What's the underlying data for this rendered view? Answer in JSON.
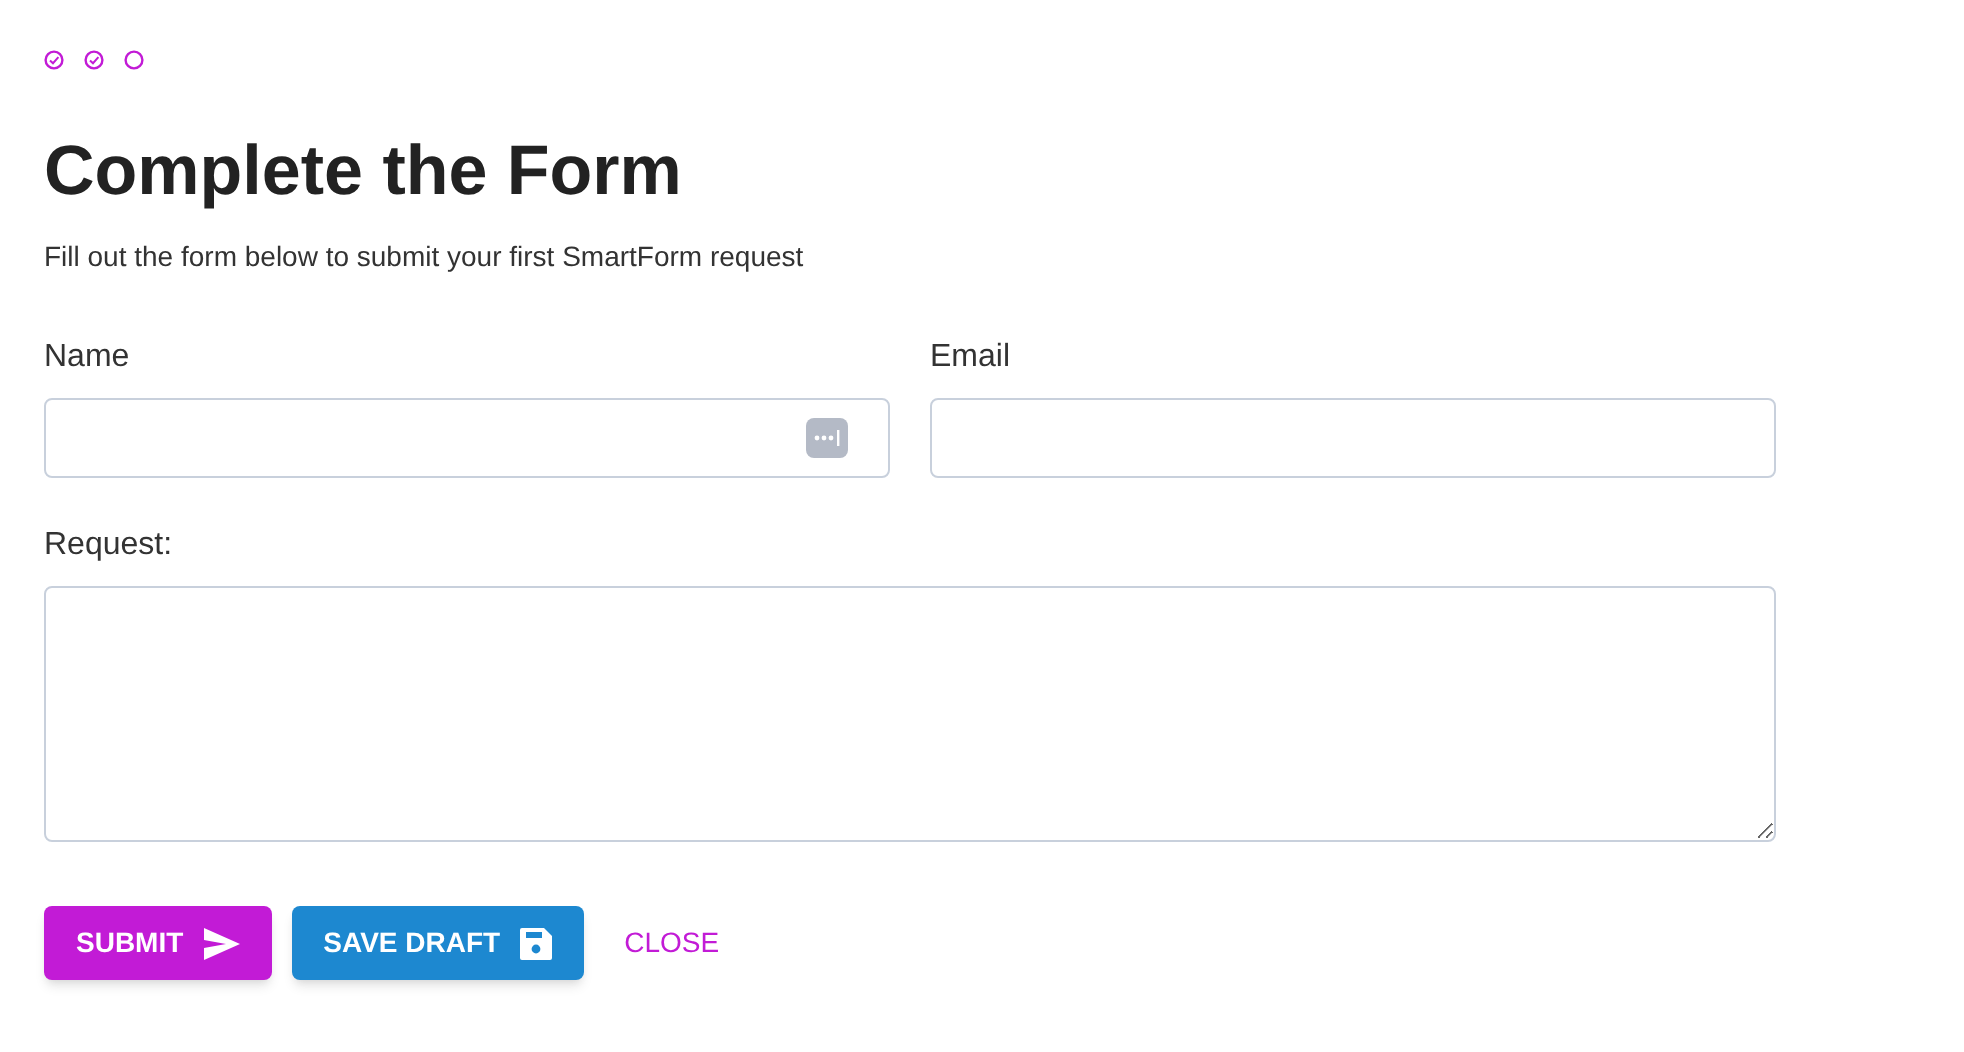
{
  "steps": [
    {
      "checked": true
    },
    {
      "checked": true
    },
    {
      "checked": false
    }
  ],
  "title": "Complete the Form",
  "subtitle": "Fill out the form below to submit your first SmartForm request",
  "fields": [
    {
      "label": "Name",
      "kind": "text",
      "autofill_button": true
    },
    {
      "label": "Email",
      "kind": "text",
      "autofill_button": false
    },
    {
      "label": "Request:",
      "kind": "textarea",
      "autofill_button": false
    }
  ],
  "buttons": [
    {
      "label": "SUBMIT",
      "kind": "primary"
    },
    {
      "label": "SAVE DRAFT",
      "kind": "secondary"
    },
    {
      "label": "CLOSE",
      "kind": "text"
    }
  ]
}
